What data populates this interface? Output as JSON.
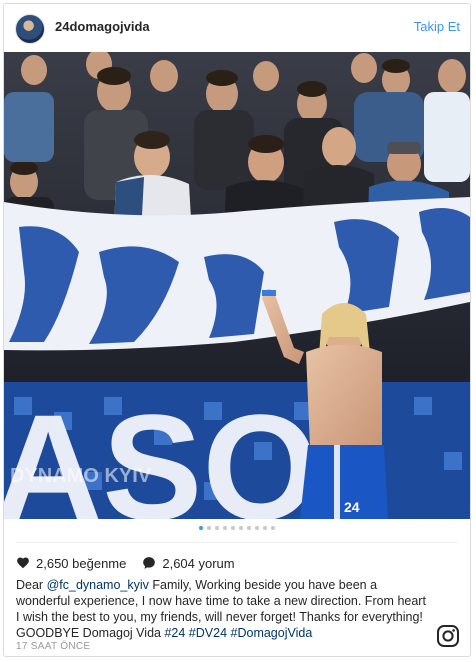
{
  "post": {
    "username": "24domagojvida",
    "follow_label": "Takip Et",
    "photo_text": {
      "banner": "DYNAMO KYIV",
      "jersey_number": "24",
      "banner_letters": "ASO"
    },
    "carousel": {
      "total": 10,
      "active_index": 0
    },
    "likes": "2,650 beğenme",
    "comments": "2,604 yorum",
    "caption": {
      "part1": "Dear ",
      "mention": "@fc_dynamo_kyiv",
      "part2": " Family, Working beside you have been a wonderful experience, I now have time to take a new direction. From heart I wish the best to you, my friends, will never forget! Thanks for everything! GOODBYE Domagoj Vida ",
      "tag1": "#24",
      "tag2": "#DV24",
      "tag3": "#DomagojVida"
    },
    "timestamp": "17 SAAT ÖNCE"
  },
  "colors": {
    "accent": "#3897f0",
    "text": "#262626",
    "muted": "#999999",
    "link": "#003569"
  },
  "icons": {
    "like": "heart-icon",
    "comment": "comment-icon",
    "brand": "instagram-icon"
  }
}
